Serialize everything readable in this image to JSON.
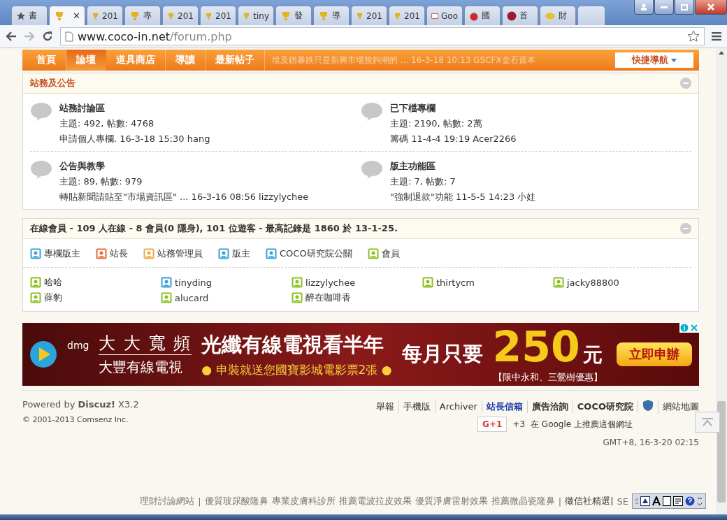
{
  "browser": {
    "tabs": [
      {
        "label": "書",
        "selected": false
      },
      {
        "selected": true,
        "close": "✕"
      },
      {
        "label": "201",
        "selected": false
      },
      {
        "label": "專",
        "selected": false
      },
      {
        "label": "201",
        "selected": false
      },
      {
        "label": "201",
        "selected": false
      },
      {
        "label": "tiny",
        "selected": false
      },
      {
        "label": "發",
        "selected": false
      },
      {
        "label": "導",
        "selected": false
      },
      {
        "label": "201",
        "selected": false
      },
      {
        "label": "201",
        "selected": false
      },
      {
        "label": "Goo",
        "selected": false
      },
      {
        "label": "國",
        "selected": false
      },
      {
        "label": "首",
        "selected": false
      },
      {
        "label": "財",
        "selected": false
      }
    ],
    "address": {
      "host": "www.coco-in.net",
      "path": "/forum.php"
    }
  },
  "ticker": "埃及鎊暴跌只是新興市場脫鉤潮的 ... 16-3-18 10:13 GSCFX金石資本",
  "nav": {
    "items": [
      {
        "label": "首頁",
        "selected": false
      },
      {
        "label": "論壇",
        "selected": true
      },
      {
        "label": "道具商店",
        "selected": false
      },
      {
        "label": "導讀",
        "selected": false
      },
      {
        "label": "最新帖子",
        "selected": false
      }
    ],
    "quick_nav": "快捷導航"
  },
  "announcements": {
    "title": "站務及公告",
    "forums": [
      {
        "name": "站務討論區",
        "stats": "主題: 492, 帖數: 4768",
        "last_post": "申請個人專欄. 16-3-18 15:30 hang"
      },
      {
        "name": "已下檔專欄",
        "stats": "主題: 2190, 帖數: 2萬",
        "last_post": "籌碼 11-4-4 19:19 Acer2266"
      },
      {
        "name": "公告與教學",
        "stats": "主題: 89, 帖數: 979",
        "last_post": "轉貼新聞請貼至\"市場資訊區\" ... 16-3-16 08:56 lizzylychee"
      },
      {
        "name": "版主功能區",
        "stats": "主題: 7, 帖數: 7",
        "last_post": "\"強制退款\"功能 11-5-5 14:23 小娃"
      }
    ]
  },
  "online": {
    "title": "在線會員",
    "summary": "- 109 人在線 - 8 會員(0 隱身), 101 位遊客 - 最高記錄是 1860 於 13-1-25.",
    "legend": [
      {
        "label": "專欄版主",
        "color": "#3aa0d8"
      },
      {
        "label": "站長",
        "color": "#e8683a"
      },
      {
        "label": "站務管理員",
        "color": "#f0a848"
      },
      {
        "label": "版主",
        "color": "#3aa0d8"
      },
      {
        "label": "COCO研究院公關",
        "color": "#3aa0d8"
      },
      {
        "label": "會員",
        "color": "#8cc020"
      }
    ],
    "members": [
      {
        "name": "哈哈",
        "color": "#8cc020"
      },
      {
        "name": "tinyding",
        "color": "#3aa0d8"
      },
      {
        "name": "lizzylychee",
        "color": "#8cc020"
      },
      {
        "name": "thirtycm",
        "color": "#8cc020"
      },
      {
        "name": "jacky88800",
        "color": "#8cc020"
      },
      {
        "name": "薛豹",
        "color": "#8cc020"
      },
      {
        "name": "alucard",
        "color": "#8cc020"
      },
      {
        "name": "醉在咖啡香",
        "color": "#8cc020"
      }
    ]
  },
  "ad": {
    "brand": "dmg",
    "headline_1": "大 大 寬 頻",
    "headline_2": "大豐有線電視",
    "main": "光纖有線電視看半年",
    "sub": "● 申裝就送您國寶影城電影票2張 ●",
    "price_prefix": "每月只要",
    "price": "250",
    "unit": "元",
    "cta": "立即申辦",
    "note": "【限中永和、三鶯樹優惠】"
  },
  "footer": {
    "powered": "Powered by **Discuz!** X3.2",
    "copyright": "© 2001-2013 Comsenz Inc.",
    "links": [
      {
        "kind": "plain",
        "label": "舉報"
      },
      {
        "kind": "plain",
        "label": "手機版"
      },
      {
        "kind": "plain",
        "label": "Archiver"
      },
      {
        "kind": "accent",
        "label": "站長信箱"
      },
      {
        "kind": "strong",
        "label": "廣告洽詢"
      },
      {
        "kind": "strong",
        "label": "COCO研究院"
      },
      {
        "kind": "badge"
      },
      {
        "kind": "plain",
        "label": "網站地圖"
      }
    ],
    "gplus": "G+1",
    "gplus_count": "+3",
    "gplus_text": "在 Google 上推薦這個網址",
    "time": "GMT+8, 16-3-20 02:15"
  },
  "bottom_links": [
    {
      "kind": "link",
      "text": "理財討論網站"
    },
    {
      "kind": "sep",
      "text": "|"
    },
    {
      "kind": "link",
      "text": "優質玻尿酸隆鼻"
    },
    {
      "kind": "link",
      "text": "專業皮膚科診所"
    },
    {
      "kind": "link",
      "text": "推薦電波拉皮效果"
    },
    {
      "kind": "link",
      "text": "優質淨膚雷射效果"
    },
    {
      "kind": "link",
      "text": "推薦微晶瓷隆鼻"
    },
    {
      "kind": "sep",
      "text": "|"
    },
    {
      "kind": "dark",
      "text": "徵信社精選|"
    },
    {
      "kind": "link",
      "text": "SE"
    }
  ]
}
